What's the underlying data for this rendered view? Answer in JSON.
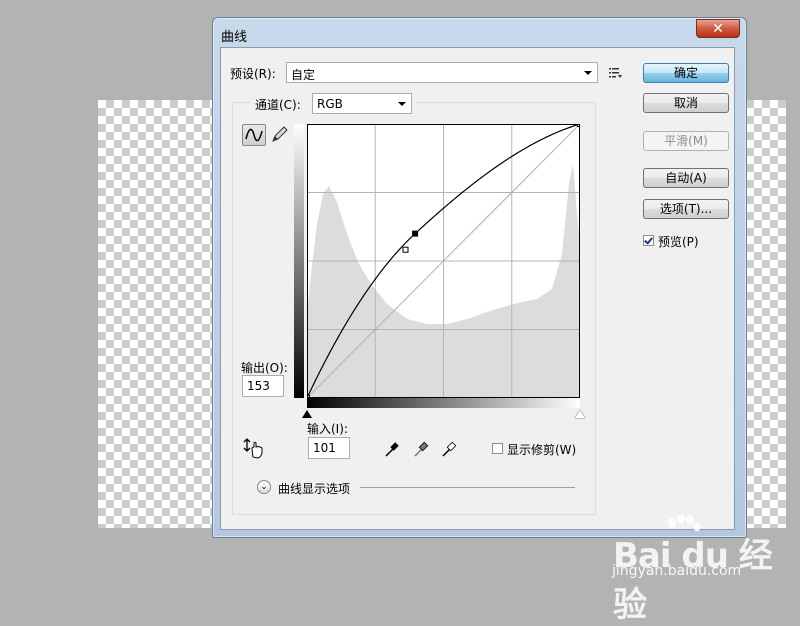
{
  "window": {
    "title": "曲线",
    "close_label": "✕"
  },
  "preset": {
    "label": "预设(R):",
    "value": "自定"
  },
  "channel": {
    "label": "通道(C):",
    "value": "RGB"
  },
  "buttons": {
    "ok": "确定",
    "cancel": "取消",
    "smooth": "平滑(M)",
    "auto": "自动(A)",
    "options": "选项(T)..."
  },
  "preview": {
    "label": "预览(P)",
    "checked": true
  },
  "output": {
    "label": "输出(O):",
    "value": "153"
  },
  "input": {
    "label": "输入(I):",
    "value": "101"
  },
  "show_clipping": {
    "label": "显示修剪(W)",
    "checked": false
  },
  "curve_display_options": {
    "label": "曲线显示选项"
  },
  "curve": {
    "points": [
      [
        0,
        0
      ],
      [
        101,
        153
      ],
      [
        255,
        255
      ]
    ],
    "selected_point": [
      101,
      153
    ]
  },
  "colors": {
    "ok_button": "#68b3db",
    "close_button": "#cf5a40",
    "window_frame": "#b3c7df"
  },
  "icons": {
    "curve_tool": "curve-wave-icon",
    "pencil_tool": "pencil-icon",
    "hand_tool": "on-image-adjust-hand-icon",
    "eyedroppers": [
      "black-point-eyedropper-icon",
      "gray-point-eyedropper-icon",
      "white-point-eyedropper-icon"
    ],
    "preset_menu": "preset-options-menu-icon",
    "expand": "double-chevron-down-icon"
  },
  "watermark": {
    "brand": "Bai du 经验",
    "url": "jingyan.baidu.com"
  }
}
